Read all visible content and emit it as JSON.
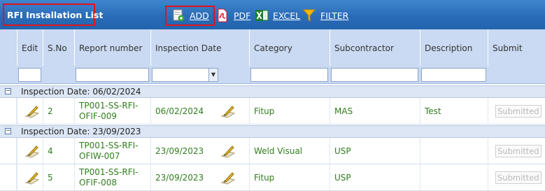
{
  "header": {
    "title": "RFI Installation List",
    "toolbar": [
      {
        "label": "ADD",
        "icon": "add-document-icon"
      },
      {
        "label": "PDF",
        "icon": "pdf-icon"
      },
      {
        "label": "EXCEL",
        "icon": "excel-icon"
      },
      {
        "label": "FILTER",
        "icon": "filter-funnel-icon"
      }
    ]
  },
  "columns": [
    "Edit",
    "S.No",
    "Report number",
    "Inspection Date",
    "Category",
    "Subcontractor",
    "Description",
    "Submit"
  ],
  "groups": [
    {
      "label": "Inspection Date: 06/02/2024",
      "rows": [
        {
          "sno": "2",
          "report": "TP001-SS-RFI-OFIF-009",
          "date": "06/02/2024",
          "category": "Fitup",
          "subcontractor": "MAS",
          "description": "Test",
          "submit": "Submitted"
        }
      ]
    },
    {
      "label": "Inspection Date: 23/09/2023",
      "rows": [
        {
          "sno": "4",
          "report": "TP001-SS-RFI-OFIW-007",
          "date": "23/09/2023",
          "category": "Weld Visual",
          "subcontractor": "USP",
          "description": "",
          "submit": "Submitted"
        },
        {
          "sno": "5",
          "report": "TP001-SS-RFI-OFIF-008",
          "date": "23/09/2023",
          "category": "Fitup",
          "subcontractor": "USP",
          "description": "",
          "submit": "Submitted"
        }
      ]
    }
  ],
  "colors": {
    "header_bg": "#2a6cb8",
    "column_header_bg": "#c9daf2",
    "group_bg": "#dce6f4",
    "cell_text": "#2f7d1c",
    "highlight_border": "#e0141b"
  }
}
